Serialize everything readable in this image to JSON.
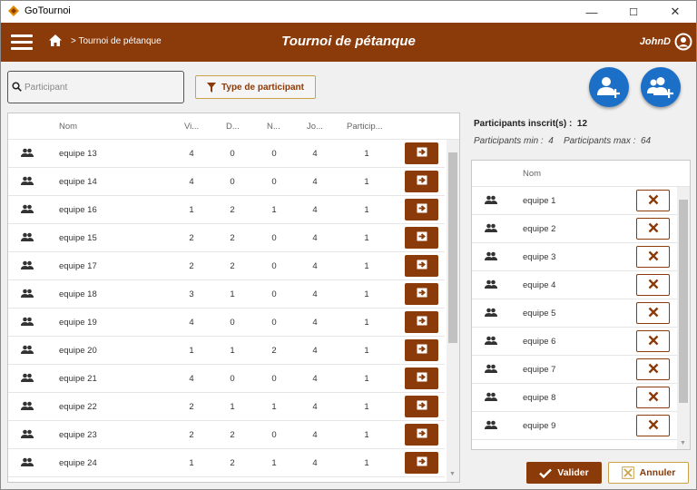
{
  "window": {
    "title": "GoTournoi",
    "controls": [
      "—",
      "☐",
      "✕"
    ]
  },
  "header": {
    "breadcrumb": "> Tournoi de pétanque",
    "title": "Tournoi de pétanque",
    "user": "JohnD",
    "color": "#8b3a09"
  },
  "search": {
    "placeholder": "Participant",
    "value": ""
  },
  "filter": {
    "label": "Type de participant"
  },
  "left_table": {
    "columns": [
      "Nom",
      "Vi...",
      "D...",
      "N...",
      "Jo...",
      "Particip..."
    ],
    "rows": [
      {
        "name": "equipe 13",
        "v": "4",
        "d": "0",
        "n": "0",
        "j": "4",
        "p": "1"
      },
      {
        "name": "equipe 14",
        "v": "4",
        "d": "0",
        "n": "0",
        "j": "4",
        "p": "1"
      },
      {
        "name": "equipe 16",
        "v": "1",
        "d": "2",
        "n": "1",
        "j": "4",
        "p": "1"
      },
      {
        "name": "equipe 15",
        "v": "2",
        "d": "2",
        "n": "0",
        "j": "4",
        "p": "1"
      },
      {
        "name": "equipe 17",
        "v": "2",
        "d": "2",
        "n": "0",
        "j": "4",
        "p": "1"
      },
      {
        "name": "equipe 18",
        "v": "3",
        "d": "1",
        "n": "0",
        "j": "4",
        "p": "1"
      },
      {
        "name": "equipe 19",
        "v": "4",
        "d": "0",
        "n": "0",
        "j": "4",
        "p": "1"
      },
      {
        "name": "equipe 20",
        "v": "1",
        "d": "1",
        "n": "2",
        "j": "4",
        "p": "1"
      },
      {
        "name": "equipe 21",
        "v": "4",
        "d": "0",
        "n": "0",
        "j": "4",
        "p": "1"
      },
      {
        "name": "equipe 22",
        "v": "2",
        "d": "1",
        "n": "1",
        "j": "4",
        "p": "1"
      },
      {
        "name": "equipe 23",
        "v": "2",
        "d": "2",
        "n": "0",
        "j": "4",
        "p": "1"
      },
      {
        "name": "equipe 24",
        "v": "1",
        "d": "2",
        "n": "1",
        "j": "4",
        "p": "1"
      }
    ]
  },
  "summary": {
    "inscrits_label": "Participants inscrit(s) :",
    "inscrits_value": "12",
    "min_label": "Participants min :",
    "min_value": "4",
    "max_label": "Participants max :",
    "max_value": "64"
  },
  "right_table": {
    "column": "Nom",
    "rows": [
      "equipe 1",
      "equipe 2",
      "equipe 3",
      "equipe 4",
      "equipe 5",
      "equipe 6",
      "equipe 7",
      "equipe 8",
      "equipe 9"
    ]
  },
  "actions": {
    "validate": "Valider",
    "cancel": "Annuler"
  }
}
